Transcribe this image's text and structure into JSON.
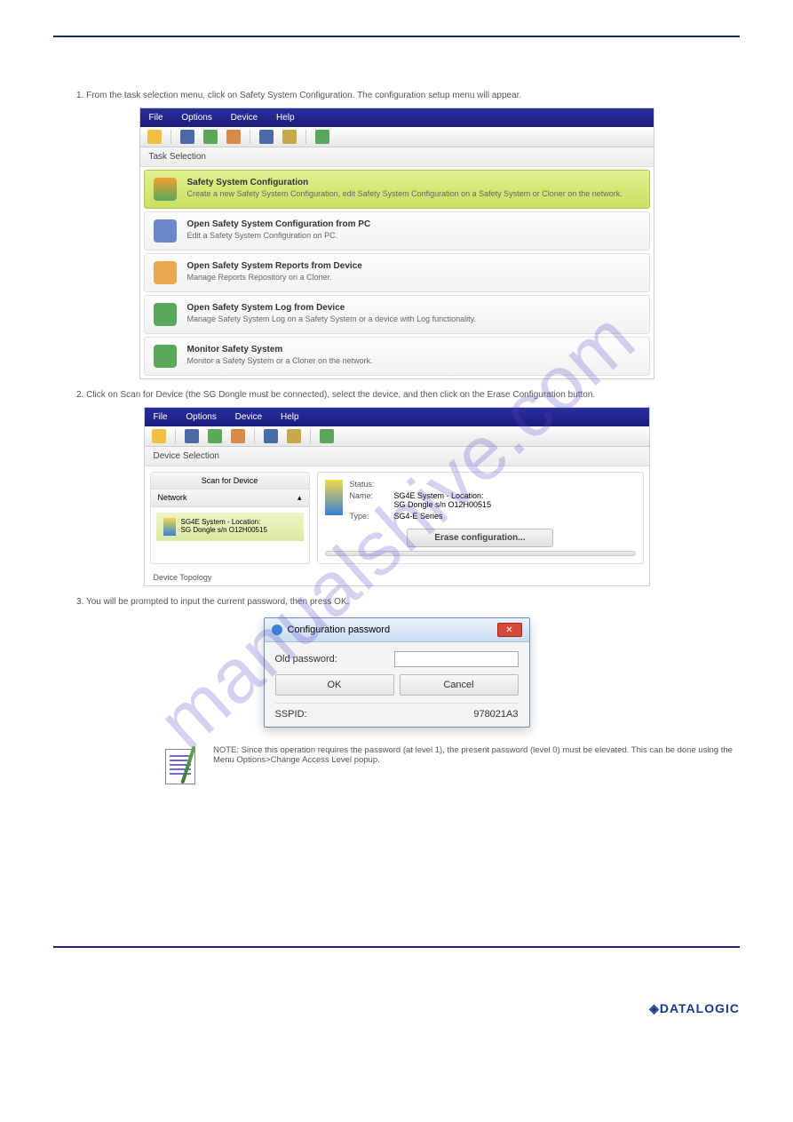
{
  "watermark": "manualshive.com",
  "steps": {
    "s1": "1. From the task selection menu, click on Safety System Configuration. The configuration setup menu will appear.",
    "s2": "2. Click on Scan for Device (the SG Dongle must be connected), select the device, and then click on the Erase Configuration button.",
    "s3": "3. You will be prompted to input the current password, then press OK."
  },
  "menubar": {
    "file": "File",
    "options": "Options",
    "device": "Device",
    "help": "Help"
  },
  "section": {
    "task": "Task Selection",
    "devsel": "Device Selection",
    "topology": "Device Topology"
  },
  "tasks": {
    "t1": {
      "title": "Safety System Configuration",
      "desc": "Create a new Safety System Configuration, edit Safety System Configuration on a Safety System or Cloner on the network."
    },
    "t2": {
      "title": "Open Safety System Configuration from PC",
      "desc": "Edit a Safety System Configuration on PC."
    },
    "t3": {
      "title": "Open Safety System Reports from Device",
      "desc": "Manage Reports Repository on a Cloner."
    },
    "t4": {
      "title": "Open Safety System Log from Device",
      "desc": "Manage Safety System Log on a Safety System or a device with Log functionality."
    },
    "t5": {
      "title": "Monitor Safety System",
      "desc": "Monitor a Safety System or a Cloner on the network."
    }
  },
  "scan": {
    "scan_button": "Scan for Device",
    "network": "Network",
    "device_line1": "SG4E System - Location:",
    "device_line2": "SG Dongle s/n O12H00515"
  },
  "details": {
    "status_lbl": "Status:",
    "name_lbl": "Name:",
    "type_lbl": "Type:",
    "name_line1": "SG4E System - Location:",
    "name_line2": "SG Dongle s/n O12H00515",
    "type_val": "SG4-E Series",
    "erase_btn": "Erase configuration..."
  },
  "dialog": {
    "title": "Configuration password",
    "old_pwd": "Old password:",
    "ok": "OK",
    "cancel": "Cancel",
    "sspid_lbl": "SSPID:",
    "sspid_val": "978021A3"
  },
  "note": "NOTE: Since this operation requires the password (at level 1), the present password (level 0) must be elevated. This can be done using the Menu Options>Change Access Level popup.",
  "footer_brand": "DATALOGIC"
}
